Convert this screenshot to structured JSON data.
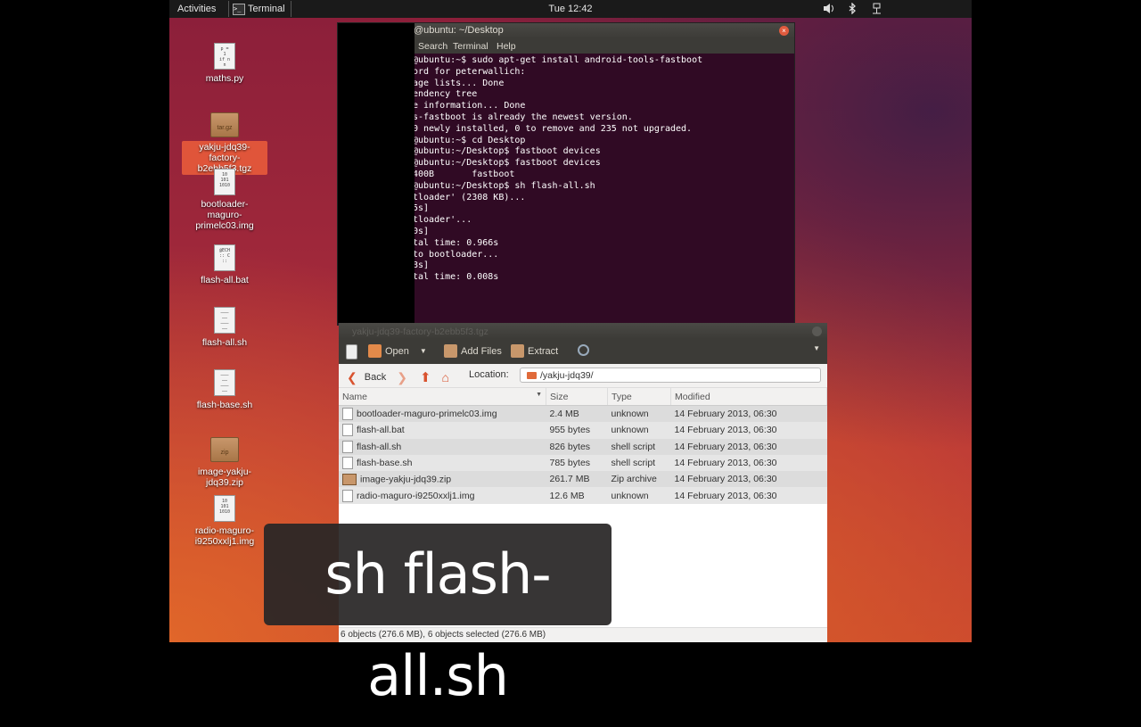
{
  "topbar": {
    "activities": "Activities",
    "app_name": "Terminal",
    "clock": "Tue 12:42"
  },
  "desktop": {
    "icons": [
      {
        "label": "maths.py",
        "glyph": "p = \n1 \nif n\n n"
      },
      {
        "label": "yakju-jdq39-factory-b2ebb5f3.tgz",
        "glyph": "tar.gz"
      },
      {
        "label": "bootloader-maguro-primelc03.img",
        "glyph": "10\n101\n1010"
      },
      {
        "label": "flash-all.bat",
        "glyph": "@ECH\n:: C\n::"
      },
      {
        "label": "flash-all.sh",
        "glyph": ""
      },
      {
        "label": "flash-base.sh",
        "glyph": ""
      },
      {
        "label": "image-yakju-jdq39.zip",
        "glyph": "zip"
      },
      {
        "label": "radio-maguro-i9250xxlj1.img",
        "glyph": "10\n101\n1010"
      }
    ]
  },
  "terminal": {
    "title": "@ubuntu: ~/Desktop",
    "menu": [
      "Search",
      "Terminal",
      "Help"
    ],
    "output": "@ubuntu:~$ sudo apt-get install android-tools-fastboot\nord for peterwallich:\nage lists... Done\nendency tree\ne information... Done\ns-fastboot is already the newest version.\n0 newly installed, 0 to remove and 235 not upgraded.\n@ubuntu:~$ cd Desktop\n@ubuntu:~/Desktop$ fastboot devices\n@ubuntu:~/Desktop$ fastboot devices\n400B       fastboot\n@ubuntu:~/Desktop$ sh flash-all.sh\ntloader' (2308 KB)...\n5s]\ntloader'...\n0s]\ntal time: 0.966s\nto bootloader...\n8s]\ntal time: 0.008s"
  },
  "archiver": {
    "title": "yakju-jdq39-factory-b2ebb5f3.tgz",
    "toolbar": {
      "open": "Open",
      "add_files": "Add Files",
      "extract": "Extract"
    },
    "back": "Back",
    "location_label": "Location:",
    "location_value": "/yakju-jdq39/",
    "columns": {
      "name": "Name",
      "size": "Size",
      "type": "Type",
      "modified": "Modified"
    },
    "files": [
      {
        "name": "bootloader-maguro-primelc03.img",
        "size": "2.4 MB",
        "type": "unknown",
        "modified": "14 February 2013, 06:30"
      },
      {
        "name": "flash-all.bat",
        "size": "955 bytes",
        "type": "unknown",
        "modified": "14 February 2013, 06:30"
      },
      {
        "name": "flash-all.sh",
        "size": "826 bytes",
        "type": "shell script",
        "modified": "14 February 2013, 06:30"
      },
      {
        "name": "flash-base.sh",
        "size": "785 bytes",
        "type": "shell script",
        "modified": "14 February 2013, 06:30"
      },
      {
        "name": "image-yakju-jdq39.zip",
        "size": "261.7 MB",
        "type": "Zip archive",
        "modified": "14 February 2013, 06:30"
      },
      {
        "name": "radio-maguro-i9250xxlj1.img",
        "size": "12.6 MB",
        "type": "unknown",
        "modified": "14 February 2013, 06:30"
      }
    ],
    "status": "6 objects (276.6 MB), 6 objects selected (276.6 MB)"
  },
  "caption": "sh flash-all.sh",
  "colors": {
    "terminal_bg": "#300a24",
    "selection": "#e0553a",
    "panel": "#1a1a1a"
  }
}
